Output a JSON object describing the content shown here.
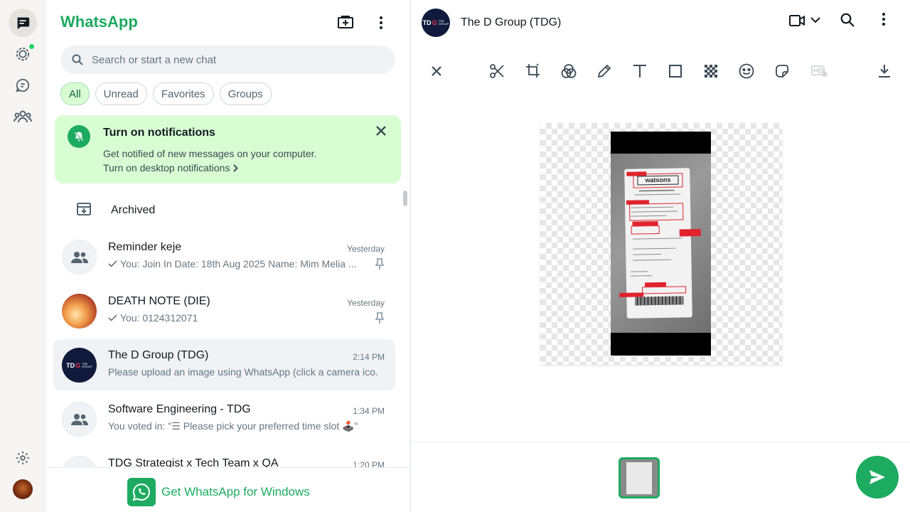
{
  "app": {
    "brand": "WhatsApp"
  },
  "rail": {
    "items": [
      {
        "name": "chats"
      },
      {
        "name": "status"
      },
      {
        "name": "channels"
      },
      {
        "name": "communities"
      }
    ]
  },
  "search": {
    "placeholder": "Search or start a new chat",
    "value": ""
  },
  "filters": [
    "All",
    "Unread",
    "Favorites",
    "Groups"
  ],
  "notification": {
    "title": "Turn on notifications",
    "body": "Get notified of new messages on your computer.",
    "link": "Turn on desktop notifications"
  },
  "archived": {
    "label": "Archived"
  },
  "chats": [
    {
      "name": "Reminder keje",
      "time": "Yesterday",
      "message": "You: Join In Date: 18th  Aug 2025 Name: Mim Melia ...",
      "pinned": true,
      "avatar": "group"
    },
    {
      "name": "DEATH NOTE (DIE)",
      "time": "Yesterday",
      "message": "You: 0124312071",
      "pinned": true,
      "avatar": "photo"
    },
    {
      "name": "The D Group (TDG)",
      "time": "2:14 PM",
      "message": "Please upload an image using WhatsApp (click a camera ico...",
      "pinned": false,
      "avatar": "tdg"
    },
    {
      "name": "Software Engineering - TDG",
      "time": "1:34 PM",
      "message": "You voted in: \"☰ Please pick your preferred time slot 🕹️\"",
      "pinned": false,
      "avatar": "group"
    },
    {
      "name": "TDG Strategist x Tech Team x QA",
      "time": "1:20 PM",
      "message": "",
      "pinned": false,
      "avatar": "group"
    }
  ],
  "get_app": {
    "label": "Get WhatsApp for Windows"
  },
  "conversation": {
    "title": "The D Group (TDG)"
  },
  "tdg_logo": {
    "t": "TDG",
    "d": "G",
    "sub1": "THE",
    "sub2": "GROUP"
  },
  "receipt_logo": "watsons",
  "colors": {
    "accent": "#1daa61",
    "notif_bg": "#d9fdd3",
    "selected_row": "#f0f2f5"
  }
}
